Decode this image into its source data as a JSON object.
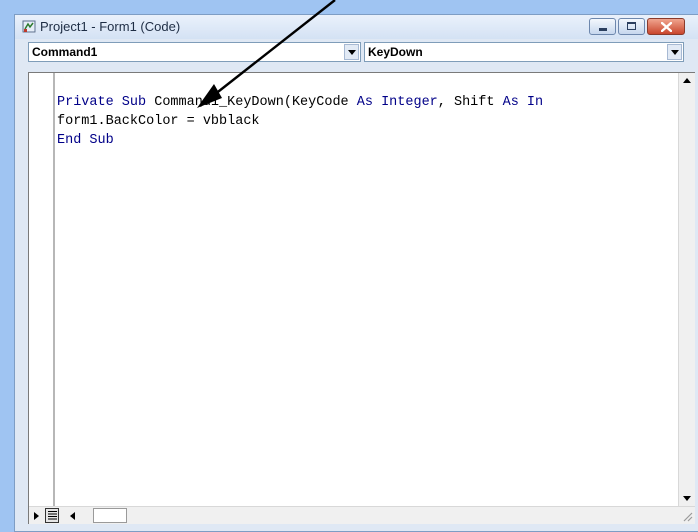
{
  "window": {
    "title": "Project1 - Form1 (Code)"
  },
  "object_combo": {
    "value": "Command1"
  },
  "procedure_combo": {
    "value": "KeyDown"
  },
  "code": {
    "lines": [
      [
        {
          "text": "Private Sub ",
          "type": "kw"
        },
        {
          "text": "Command1_KeyDown(KeyCode ",
          "type": "id"
        },
        {
          "text": "As Integer",
          "type": "kw"
        },
        {
          "text": ", Shift ",
          "type": "id"
        },
        {
          "text": "As In",
          "type": "kw"
        }
      ],
      [
        {
          "text": "form1.BackColor = vbblack",
          "type": "id"
        }
      ],
      [
        {
          "text": "End Sub",
          "type": "kw"
        }
      ]
    ]
  },
  "icons": {
    "app": "vb-project-icon",
    "minimize": "minimize-icon",
    "maximize": "maximize-icon",
    "close": "close-icon",
    "dropdown": "chevron-down-icon",
    "procedure_view": "procedure-view-icon",
    "full_module_view": "full-module-view-icon"
  },
  "colors": {
    "keyword": "#000088",
    "identifier": "#000000",
    "desktop": "#9fc4f2",
    "close_button": "#c9462d"
  }
}
